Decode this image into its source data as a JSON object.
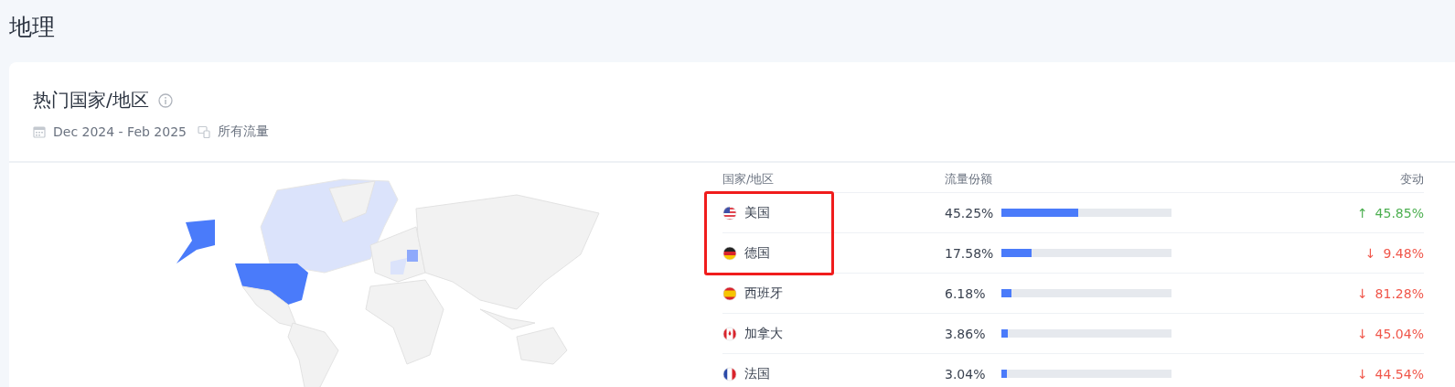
{
  "page_title": "地理",
  "card": {
    "title": "热门国家/地区",
    "date_range": "Dec 2024 - Feb 2025",
    "traffic": "所有流量"
  },
  "table": {
    "columns": [
      "国家/地区",
      "流量份额",
      "变动"
    ],
    "rows": [
      {
        "country": "美国",
        "share": "45.25%",
        "level": 0.4525,
        "change": "45.85%",
        "arrow": "↑",
        "increase": true,
        "highlighted": true
      },
      {
        "country": "德国",
        "share": "17.58%",
        "level": 0.1758,
        "change": "9.48%",
        "arrow": "↓",
        "increase": false,
        "highlighted": true
      },
      {
        "country": "西班牙",
        "share": "6.18%",
        "level": 0.0618,
        "change": "81.28%",
        "arrow": "↓",
        "increase": false,
        "highlighted": false
      },
      {
        "country": "加拿大",
        "share": "3.86%",
        "level": 0.0386,
        "change": "45.04%",
        "arrow": "↓",
        "increase": false,
        "highlighted": false
      },
      {
        "country": "法国",
        "share": "3.04%",
        "level": 0.0304,
        "change": "44.54%",
        "arrow": "↓",
        "increase": false,
        "highlighted": false
      }
    ]
  }
}
